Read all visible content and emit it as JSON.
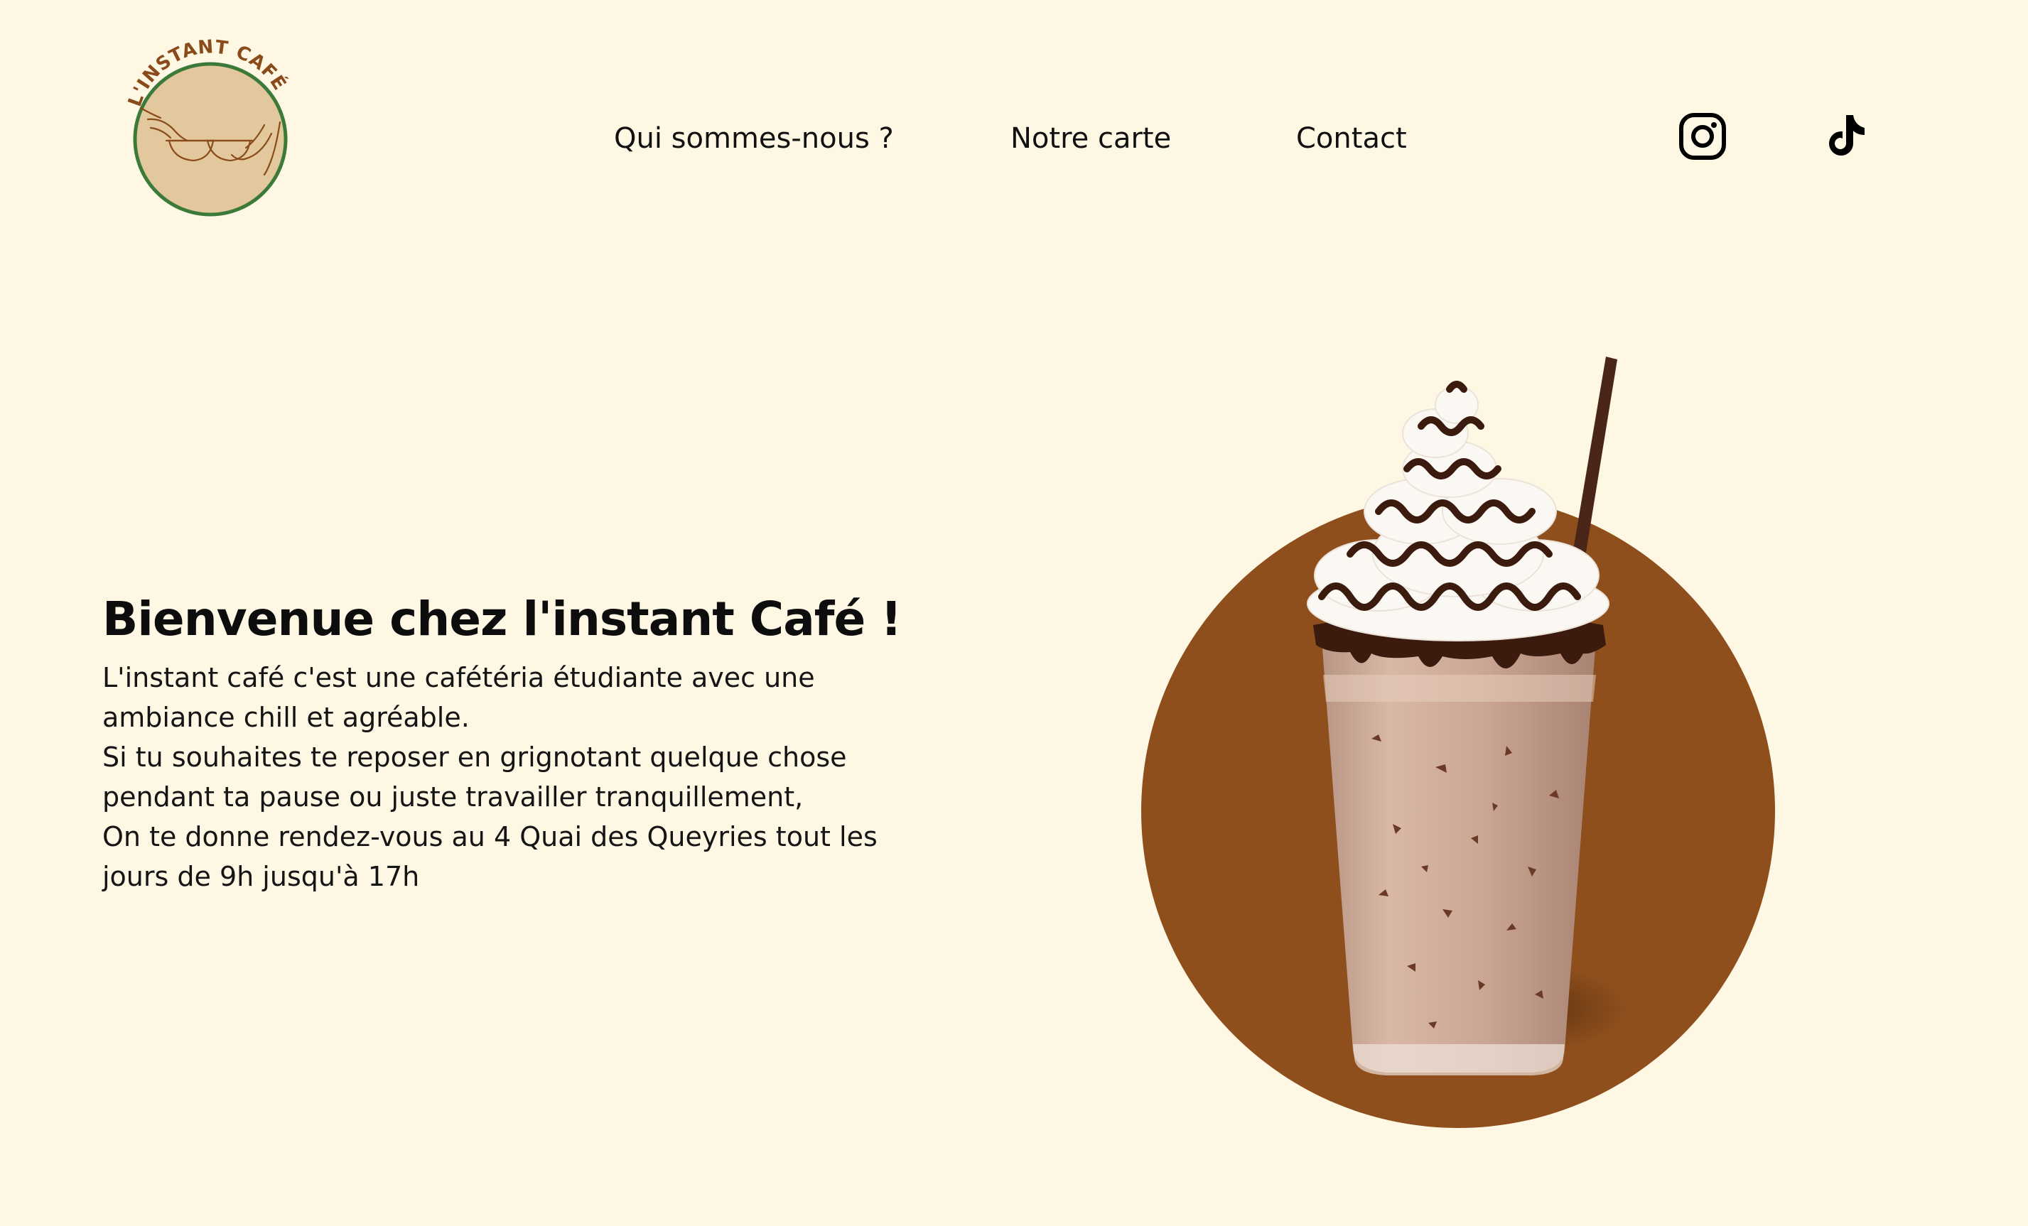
{
  "logo": {
    "text": "L'INSTANT CAFÉ"
  },
  "nav": {
    "items": [
      {
        "label": "Qui sommes-nous ?"
      },
      {
        "label": "Notre carte"
      },
      {
        "label": "Contact"
      }
    ],
    "social": [
      {
        "icon": "instagram-icon"
      },
      {
        "icon": "tiktok-icon"
      }
    ]
  },
  "hero": {
    "title": "Bienvenue chez l'instant Café !",
    "paragraphs": [
      "L'instant café c'est une cafétéria étudiante avec une ambiance chill et agréable.",
      "Si tu souhaites te reposer en grignotant quelque chose pendant ta pause ou juste travailler tranquillement,",
      "On te donne rendez-vous au 4 Quai des Queyries tout les jours de 9h jusqu'à 17h"
    ]
  },
  "colors": {
    "background": "#fdf7e3",
    "accent_circle": "#8e4f1d",
    "logo_ring": "#3c7a3a",
    "logo_fill": "#e3c79d",
    "text": "#111111"
  }
}
